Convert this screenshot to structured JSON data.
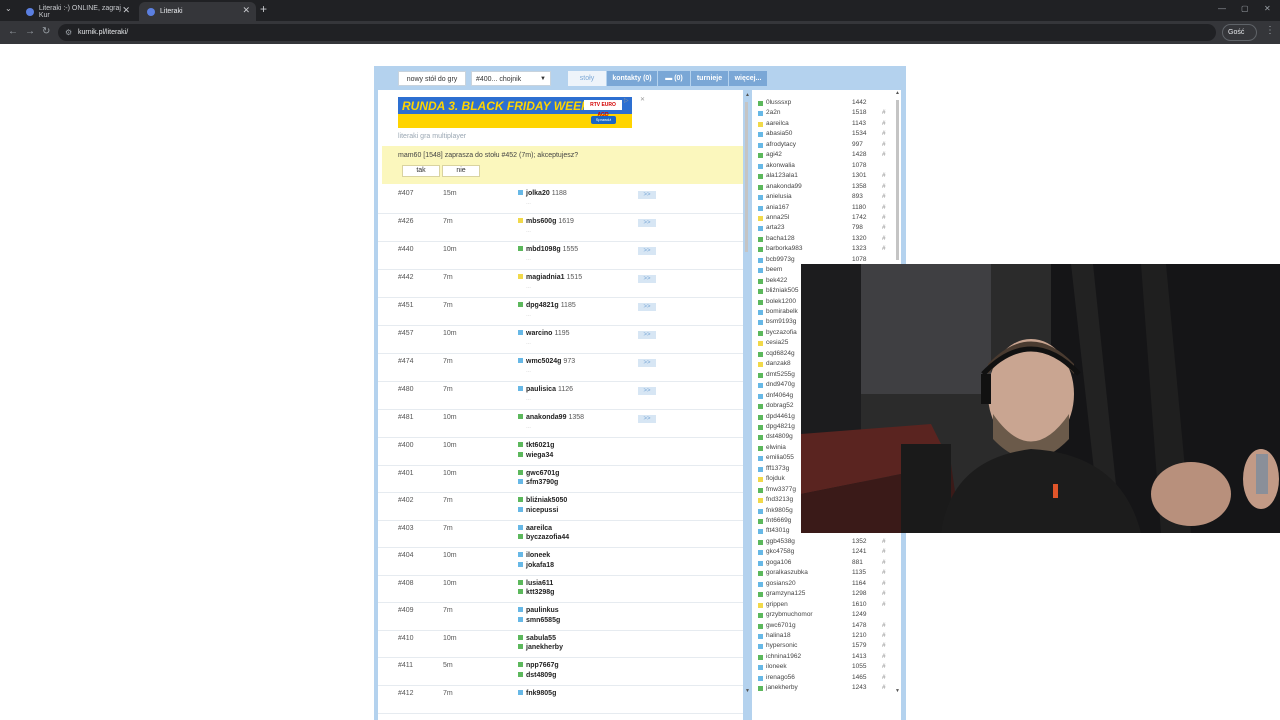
{
  "browser": {
    "tabs": [
      {
        "title": "Literaki :-) ONLINE, zagraj - Kur",
        "active": false
      },
      {
        "title": "Literaki",
        "active": true
      }
    ],
    "url": "kurnik.pl/literaki/",
    "profile_label": "Gość"
  },
  "site": {
    "nav": {
      "new_table": "nowy stół do gry",
      "room_select": "#400... chojnik",
      "tables": "stoły",
      "contacts": "kontakty (0)",
      "messages": "(0)",
      "tournaments": "turnieje",
      "more": "więcej..."
    },
    "ad": {
      "headline": "RUNDA 3. BLACK FRIDAY WEEKS",
      "brand": "RTV EURO AGD",
      "cta": "Sprawdź"
    },
    "tagline": "literaki gra multiplayer",
    "invite": {
      "text": "mam60 [1548] zaprasza do stołu #452 (7m); akceptujesz?",
      "yes": "tak",
      "no": "nie"
    },
    "tables": [
      {
        "num": "#407",
        "time": "15m",
        "players": [
          {
            "name": "jolka20",
            "rank": "1188",
            "color": "#67b8e6"
          }
        ],
        "join": ">>"
      },
      {
        "num": "#426",
        "time": "7m",
        "players": [
          {
            "name": "mbs600g",
            "rank": "1619",
            "color": "#f1d94a"
          }
        ],
        "join": ">>"
      },
      {
        "num": "#440",
        "time": "10m",
        "players": [
          {
            "name": "mbd1098g",
            "rank": "1555",
            "color": "#5cb85c"
          }
        ],
        "join": ">>"
      },
      {
        "num": "#442",
        "time": "7m",
        "players": [
          {
            "name": "magiadnia1",
            "rank": "1515",
            "color": "#f1d94a"
          }
        ],
        "join": ">>"
      },
      {
        "num": "#451",
        "time": "7m",
        "players": [
          {
            "name": "dpg4821g",
            "rank": "1185",
            "color": "#5cb85c"
          }
        ],
        "join": ">>"
      },
      {
        "num": "#457",
        "time": "10m",
        "players": [
          {
            "name": "warcino",
            "rank": "1195",
            "color": "#67b8e6"
          }
        ],
        "join": ">>"
      },
      {
        "num": "#474",
        "time": "7m",
        "players": [
          {
            "name": "wmc5024g",
            "rank": "973",
            "color": "#67b8e6"
          }
        ],
        "join": ">>"
      },
      {
        "num": "#480",
        "time": "7m",
        "players": [
          {
            "name": "paulisica",
            "rank": "1126",
            "color": "#67b8e6"
          }
        ],
        "join": ">>"
      },
      {
        "num": "#481",
        "time": "10m",
        "players": [
          {
            "name": "anakonda99",
            "rank": "1358",
            "color": "#5cb85c"
          }
        ],
        "join": ">>"
      },
      {
        "num": "#400",
        "time": "10m",
        "players": [
          {
            "name": "tkt6021g",
            "rank": "",
            "color": "#5cb85c"
          },
          {
            "name": "wiega34",
            "rank": "",
            "color": "#5cb85c"
          }
        ],
        "join": ""
      },
      {
        "num": "#401",
        "time": "10m",
        "players": [
          {
            "name": "gwc6701g",
            "rank": "",
            "color": "#5cb85c"
          },
          {
            "name": "sfm3790g",
            "rank": "",
            "color": "#67b8e6"
          }
        ],
        "join": ""
      },
      {
        "num": "#402",
        "time": "7m",
        "players": [
          {
            "name": "bliźniak5050",
            "rank": "",
            "color": "#5cb85c"
          },
          {
            "name": "nicepussi",
            "rank": "",
            "color": "#67b8e6"
          }
        ],
        "join": ""
      },
      {
        "num": "#403",
        "time": "7m",
        "players": [
          {
            "name": "aareilca",
            "rank": "",
            "color": "#67b8e6"
          },
          {
            "name": "byczazofia44",
            "rank": "",
            "color": "#5cb85c"
          }
        ],
        "join": ""
      },
      {
        "num": "#404",
        "time": "10m",
        "players": [
          {
            "name": "iloneek",
            "rank": "",
            "color": "#67b8e6"
          },
          {
            "name": "jokafa18",
            "rank": "",
            "color": "#67b8e6"
          }
        ],
        "join": ""
      },
      {
        "num": "#408",
        "time": "10m",
        "players": [
          {
            "name": "lusia611",
            "rank": "",
            "color": "#5cb85c"
          },
          {
            "name": "ktt3298g",
            "rank": "",
            "color": "#5cb85c"
          }
        ],
        "join": ""
      },
      {
        "num": "#409",
        "time": "7m",
        "players": [
          {
            "name": "paulinkus",
            "rank": "",
            "color": "#67b8e6"
          },
          {
            "name": "smn6585g",
            "rank": "",
            "color": "#67b8e6"
          }
        ],
        "join": ""
      },
      {
        "num": "#410",
        "time": "10m",
        "players": [
          {
            "name": "sabula55",
            "rank": "",
            "color": "#5cb85c"
          },
          {
            "name": "janekherby",
            "rank": "",
            "color": "#5cb85c"
          }
        ],
        "join": ""
      },
      {
        "num": "#411",
        "time": "5m",
        "players": [
          {
            "name": "npp7667g",
            "rank": "",
            "color": "#5cb85c"
          },
          {
            "name": "dst4809g",
            "rank": "",
            "color": "#5cb85c"
          }
        ],
        "join": ""
      },
      {
        "num": "#412",
        "time": "7m",
        "players": [
          {
            "name": "fnk9805g",
            "rank": "",
            "color": "#67b8e6"
          }
        ],
        "join": ""
      }
    ],
    "users": [
      {
        "name": "0lusssxp",
        "rank": "1442",
        "mark": "",
        "color": "#5cb85c"
      },
      {
        "name": "2a2n",
        "rank": "1518",
        "mark": "#",
        "color": "#67b8e6"
      },
      {
        "name": "aareilca",
        "rank": "1143",
        "mark": "#",
        "color": "#f1d94a"
      },
      {
        "name": "abasia50",
        "rank": "1534",
        "mark": "#",
        "color": "#67b8e6"
      },
      {
        "name": "afrodytacy",
        "rank": "997",
        "mark": "#",
        "color": "#67b8e6"
      },
      {
        "name": "agi42",
        "rank": "1428",
        "mark": "#",
        "color": "#5cb85c"
      },
      {
        "name": "akonwalia",
        "rank": "1078",
        "mark": "",
        "color": "#67b8e6"
      },
      {
        "name": "ala123ala1",
        "rank": "1301",
        "mark": "#",
        "color": "#5cb85c"
      },
      {
        "name": "anakonda99",
        "rank": "1358",
        "mark": "#",
        "color": "#5cb85c"
      },
      {
        "name": "anielusia",
        "rank": "893",
        "mark": "#",
        "color": "#67b8e6"
      },
      {
        "name": "ania167",
        "rank": "1180",
        "mark": "#",
        "color": "#67b8e6"
      },
      {
        "name": "anna25l",
        "rank": "1742",
        "mark": "#",
        "color": "#f1d94a"
      },
      {
        "name": "arta23",
        "rank": "798",
        "mark": "#",
        "color": "#67b8e6"
      },
      {
        "name": "bacha128",
        "rank": "1320",
        "mark": "#",
        "color": "#5cb85c"
      },
      {
        "name": "barborka983",
        "rank": "1323",
        "mark": "#",
        "color": "#5cb85c"
      },
      {
        "name": "bcb9973g",
        "rank": "1078",
        "mark": "",
        "color": "#67b8e6"
      },
      {
        "name": "beem",
        "rank": "",
        "mark": "",
        "color": "#67b8e6"
      },
      {
        "name": "bek422",
        "rank": "",
        "mark": "",
        "color": "#5cb85c"
      },
      {
        "name": "bliźniak505",
        "rank": "",
        "mark": "",
        "color": "#5cb85c"
      },
      {
        "name": "bolek1200",
        "rank": "",
        "mark": "",
        "color": "#5cb85c"
      },
      {
        "name": "bomirabelk",
        "rank": "",
        "mark": "",
        "color": "#67b8e6"
      },
      {
        "name": "bsm9193g",
        "rank": "",
        "mark": "",
        "color": "#67b8e6"
      },
      {
        "name": "byczazofia",
        "rank": "",
        "mark": "",
        "color": "#5cb85c"
      },
      {
        "name": "cesia25",
        "rank": "",
        "mark": "",
        "color": "#f1d94a"
      },
      {
        "name": "cqd6824g",
        "rank": "",
        "mark": "",
        "color": "#5cb85c"
      },
      {
        "name": "danzak8",
        "rank": "",
        "mark": "",
        "color": "#f1d94a"
      },
      {
        "name": "dmt5255g",
        "rank": "",
        "mark": "",
        "color": "#5cb85c"
      },
      {
        "name": "dnd9470g",
        "rank": "",
        "mark": "",
        "color": "#67b8e6"
      },
      {
        "name": "dnf4064g",
        "rank": "",
        "mark": "",
        "color": "#67b8e6"
      },
      {
        "name": "dobrag52",
        "rank": "",
        "mark": "",
        "color": "#5cb85c"
      },
      {
        "name": "dpd4461g",
        "rank": "",
        "mark": "",
        "color": "#5cb85c"
      },
      {
        "name": "dpg4821g",
        "rank": "",
        "mark": "",
        "color": "#5cb85c"
      },
      {
        "name": "dst4809g",
        "rank": "",
        "mark": "",
        "color": "#5cb85c"
      },
      {
        "name": "elwinia",
        "rank": "",
        "mark": "",
        "color": "#5cb85c"
      },
      {
        "name": "emilia055",
        "rank": "",
        "mark": "",
        "color": "#67b8e6"
      },
      {
        "name": "fff1373g",
        "rank": "",
        "mark": "",
        "color": "#67b8e6"
      },
      {
        "name": "flojduk",
        "rank": "",
        "mark": "",
        "color": "#f1d94a"
      },
      {
        "name": "fmw3377g",
        "rank": "",
        "mark": "",
        "color": "#5cb85c"
      },
      {
        "name": "fnd3213g",
        "rank": "",
        "mark": "",
        "color": "#f1d94a"
      },
      {
        "name": "fnk9805g",
        "rank": "",
        "mark": "",
        "color": "#67b8e6"
      },
      {
        "name": "fnt6669g",
        "rank": "",
        "mark": "",
        "color": "#5cb85c"
      },
      {
        "name": "ftt4301g",
        "rank": "",
        "mark": "",
        "color": "#67b8e6"
      },
      {
        "name": "ggb4538g",
        "rank": "1352",
        "mark": "#",
        "color": "#5cb85c"
      },
      {
        "name": "gkc4758g",
        "rank": "1241",
        "mark": "#",
        "color": "#67b8e6"
      },
      {
        "name": "goga106",
        "rank": "881",
        "mark": "#",
        "color": "#67b8e6"
      },
      {
        "name": "goralkaszubka",
        "rank": "1135",
        "mark": "#",
        "color": "#5cb85c"
      },
      {
        "name": "gosians20",
        "rank": "1164",
        "mark": "#",
        "color": "#67b8e6"
      },
      {
        "name": "gramzyna125",
        "rank": "1298",
        "mark": "#",
        "color": "#5cb85c"
      },
      {
        "name": "grippen",
        "rank": "1610",
        "mark": "#",
        "color": "#f1d94a"
      },
      {
        "name": "grzybmuchomor",
        "rank": "1249",
        "mark": "",
        "color": "#5cb85c"
      },
      {
        "name": "gwc6701g",
        "rank": "1478",
        "mark": "#",
        "color": "#5cb85c"
      },
      {
        "name": "halina18",
        "rank": "1210",
        "mark": "#",
        "color": "#67b8e6"
      },
      {
        "name": "hypersonic",
        "rank": "1579",
        "mark": "#",
        "color": "#67b8e6"
      },
      {
        "name": "ichnina1962",
        "rank": "1413",
        "mark": "#",
        "color": "#5cb85c"
      },
      {
        "name": "iloneek",
        "rank": "1055",
        "mark": "#",
        "color": "#67b8e6"
      },
      {
        "name": "irenago56",
        "rank": "1465",
        "mark": "#",
        "color": "#67b8e6"
      },
      {
        "name": "janekherby",
        "rank": "1243",
        "mark": "#",
        "color": "#5cb85c"
      }
    ]
  }
}
